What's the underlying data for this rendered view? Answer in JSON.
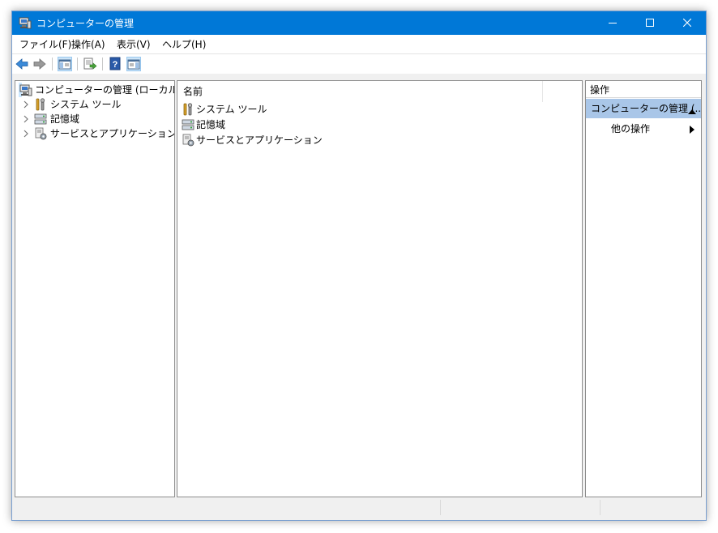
{
  "window": {
    "title": "コンピューターの管理",
    "accent_color": "#0078d7",
    "controls": [
      "minimize-icon",
      "maximize-icon",
      "close-icon"
    ]
  },
  "menu": {
    "file": "ファイル(F)",
    "action": "操作(A)",
    "view": "表示(V)",
    "help": "ヘルプ(H)"
  },
  "toolbar": {
    "buttons": [
      "back-arrow-icon",
      "forward-arrow-icon",
      "show-console-tree-icon",
      "export-list-icon",
      "help-icon",
      "show-action-pane-icon"
    ]
  },
  "tree": {
    "root": "コンピューターの管理 (ローカル)",
    "items": [
      {
        "label": "システム ツール",
        "icon": "system-tools-icon"
      },
      {
        "label": "記憶域",
        "icon": "storage-icon"
      },
      {
        "label": "サービスとアプリケーション",
        "icon": "services-apps-icon"
      }
    ]
  },
  "list": {
    "column_name": "名前",
    "rows": [
      {
        "label": "システム ツール",
        "icon": "system-tools-icon"
      },
      {
        "label": "記憶域",
        "icon": "storage-icon"
      },
      {
        "label": "サービスとアプリケーション",
        "icon": "services-apps-icon"
      }
    ]
  },
  "actions": {
    "title": "操作",
    "group": "コンピューターの管理 (...",
    "group_highlight": "#a9c6e8",
    "item": "他の操作"
  }
}
